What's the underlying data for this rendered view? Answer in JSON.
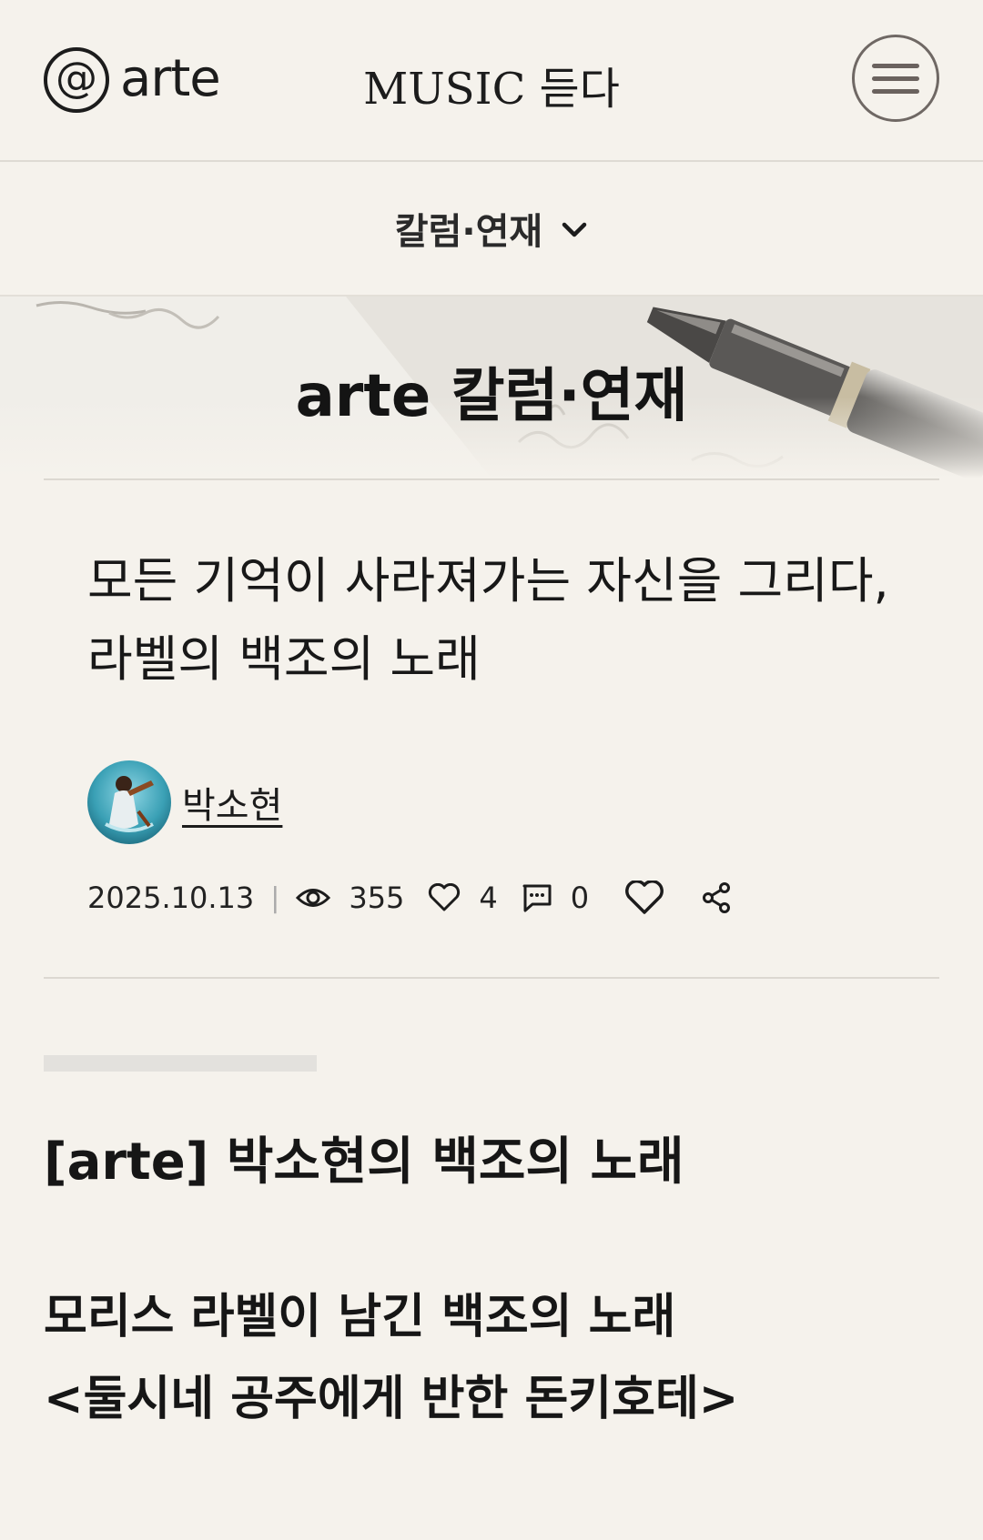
{
  "header": {
    "logo_mark": "@",
    "logo_text": "arte",
    "site_title": "MUSIC 듣다"
  },
  "category": {
    "label": "칼럼·연재"
  },
  "hero": {
    "title": "arte 칼럼·연재"
  },
  "article": {
    "title": "모든 기억이 사라져가는 자신을 그리다, 라벨의 백조의 노래",
    "author": "박소현",
    "date": "2025.10.13",
    "separator": "|",
    "views": "355",
    "likes": "4",
    "comments": "0"
  },
  "body": {
    "series_heading": "[arte] 박소현의 백조의 노래",
    "subheading_line1": "모리스 라벨이 남긴 백조의 노래",
    "subheading_line2": "<둘시네 공주에게 반한 돈키호테>"
  },
  "icons": {
    "menu": "hamburger-menu-icon",
    "chevron": "chevron-down-icon",
    "views": "eye-icon",
    "likes": "heart-icon",
    "comments": "comment-icon",
    "like_button": "heart-outline-icon",
    "share": "share-icon"
  },
  "colors": {
    "background": "#f5f2ec",
    "text": "#1c1c1c",
    "divider": "#dcd8d1"
  }
}
